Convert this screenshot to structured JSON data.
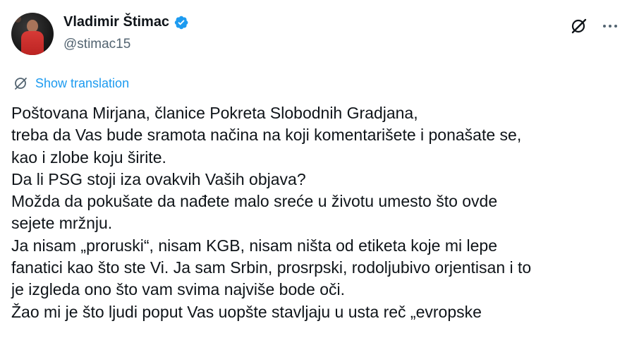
{
  "author": {
    "display_name": "Vladimir Štimac",
    "handle": "@stimac15",
    "verified": true
  },
  "actions": {
    "grok_icon": "grok-icon",
    "more_icon": "more-icon"
  },
  "translation": {
    "label": "Show translation",
    "icon": "globe-icon"
  },
  "tweet": {
    "lines": [
      "Poštovana Mirjana, članice Pokreta Slobodnih Gradjana,",
      "treba da Vas bude sramota načina na koji komentarišete i ponašate se,",
      "kao i zlobe koju širite.",
      "Da li PSG stoji iza ovakvih Vaših objava?",
      "Možda da pokušate da nađete malo sreće u životu umesto što ovde",
      "sejete mržnju.",
      "Ja nisam „proruski“, nisam KGB, nisam ništa od etiketa koje mi lepe",
      "fanatici kao što ste Vi. Ja sam Srbin, prosrpski, rodoljubivo orjentisan i to",
      "je izgleda ono što vam svima najviše bode oči.",
      "Žao mi je što ljudi poput Vas uopšte stavljaju u usta reč „evropske"
    ]
  },
  "colors": {
    "text": "#0f1419",
    "secondary": "#536471",
    "accent": "#1d9bf0"
  }
}
